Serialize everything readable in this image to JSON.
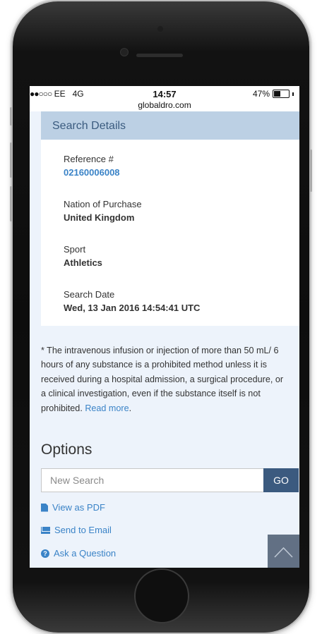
{
  "status_bar": {
    "carrier": "EE",
    "network": "4G",
    "time": "14:57",
    "battery": "47%",
    "battery_level": 0.47,
    "url": "globaldro.com"
  },
  "search_details": {
    "header": "Search Details",
    "fields": [
      {
        "label": "Reference #",
        "value": "02160006008"
      },
      {
        "label": "Nation of Purchase",
        "value": "United Kingdom"
      },
      {
        "label": "Sport",
        "value": "Athletics"
      },
      {
        "label": "Search Date",
        "value": "Wed, 13 Jan 2016 14:54:41 UTC"
      }
    ]
  },
  "note": {
    "text": "* The intravenous infusion or injection of more than 50 mL/ 6 hours of any substance is a prohibited method unless it is received during a hospital admission, a surgical procedure, or a clinical investigation, even if the substance itself is not prohibited.",
    "link": "Read more",
    "end": "."
  },
  "options": {
    "title": "Options",
    "search_placeholder": "New Search",
    "go_label": "GO",
    "links": {
      "pdf": "View as PDF",
      "email": "Send to Email",
      "question": "Ask a Question"
    }
  },
  "icons": {
    "pdf": "file-icon",
    "email": "envelope-icon",
    "question": "question-circle-icon",
    "scroll": "chevron-up-icon"
  },
  "colors": {
    "link": "#3a83c7",
    "header_bg": "#bcd0e4",
    "button_bg": "#3b5a7f",
    "page_bg": "#edf3fb"
  }
}
